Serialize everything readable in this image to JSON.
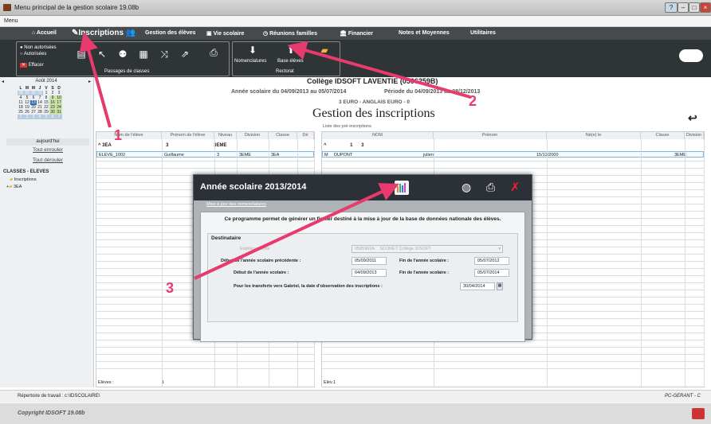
{
  "window": {
    "title": "Menu principal de la gestion scolaire 19.08b",
    "user_label": "PC-GERANT - C"
  },
  "menubar": {
    "menu": "Menu"
  },
  "nav": {
    "accueil": "Accueil",
    "inscriptions": "Inscriptions",
    "eleves": "Gestion des élèves",
    "vie": "Vie scolaire",
    "reunions": "Réunions familles",
    "financier": "Financier",
    "notes": "Notes et Moyennes",
    "utilitaires": "Utilitaires"
  },
  "ribbon": {
    "non_autorisees": "Non autorisées",
    "autorisees": "Autorisées",
    "effacer": "Effacer",
    "passages": "Passages de classes",
    "nomenclatures": "Nomenclatures",
    "base_eleves": "Base élèves",
    "rectorat": "Rectorat"
  },
  "calendar": {
    "month": "Août 2014",
    "days": [
      "L",
      "M",
      "M",
      "J",
      "V",
      "S",
      "D"
    ],
    "rows": [
      [
        "28",
        "29",
        "30",
        "31",
        "1",
        "2",
        "3"
      ],
      [
        "4",
        "5",
        "6",
        "7",
        "8",
        "9",
        "10"
      ],
      [
        "11",
        "12",
        "13",
        "14",
        "15",
        "16",
        "17"
      ],
      [
        "18",
        "19",
        "20",
        "21",
        "22",
        "23",
        "24"
      ],
      [
        "25",
        "26",
        "27",
        "28",
        "29",
        "30",
        "31"
      ],
      [
        "1",
        "2",
        "3",
        "4",
        "5",
        "6",
        "7"
      ]
    ],
    "today": "aujourd'hui",
    "enroll_all": "Tout enrouler",
    "unroll_all": "Tout dérouler"
  },
  "tree": {
    "title": "CLASSES - ELEVES",
    "items": [
      "Inscriptions",
      "3EA"
    ]
  },
  "header": {
    "college": "Collège IDSOFT LAVENTIE (0596259B)",
    "annee": "Année scolaire du 04/09/2013 au 05/07/2014",
    "periode": "Période du 04/09/2013 au 08/12/2013",
    "classe": "3 EURO - ANGLAIS EURO - 0",
    "page_title": "Gestion des inscriptions",
    "list_label": "Liste des pré-inscriptions"
  },
  "left_table": {
    "columns": [
      "Nom de l'élève",
      "Prénom de l'élève",
      "Niveau",
      "Division",
      "Classe",
      "Dé"
    ],
    "group": [
      "3EA",
      "3",
      "3EME"
    ],
    "row": [
      "ELEVE_1002",
      "Guillaume",
      "3",
      "3EME",
      "3EA",
      ""
    ],
    "footer_label": "Elèves :",
    "footer_count": "1"
  },
  "right_table": {
    "columns": [
      "NOM",
      "Prénom",
      "Né(e) le",
      "Classe",
      "Division"
    ],
    "group": [
      "1",
      "3"
    ],
    "row": [
      "M",
      "DUPONT",
      "julien",
      "15/12/2000",
      "",
      "3EME"
    ],
    "footer_label": "Elèv.1"
  },
  "dialog": {
    "title": "Année scolaire 2013/2014",
    "tab": "Mise à jour des nomenclatures",
    "intro": "Ce programme permet de générer un fichier destiné à la mise à jour de la base de données nationale des élèves.",
    "section": "Destinataire",
    "etab_label": "Etablissements",
    "etab_code": "0595962A",
    "etab_name": "SCONET Collège IDSOFT",
    "prev_start_label": "Début de l'année scolaire précédente :",
    "prev_start": "05/09/2011",
    "prev_end_label": "Fin de l'année scolaire :",
    "prev_end": "05/07/2012",
    "start_label": "Début de l'année scolaire :",
    "start": "04/09/2013",
    "end_label": "Fin de l'année scolaire :",
    "end": "05/07/2014",
    "transfer_label": "Pour les transferts vers Gabriel, la date d'observation des inscriptions :",
    "transfer": "30/04/2014"
  },
  "status": {
    "path": "Répertoire de travail : c:\\IDSCOLAIRE\\"
  },
  "footer": {
    "copyright": "Copyright IDSOFT 19.08b"
  },
  "annotations": [
    "1",
    "2",
    "3"
  ],
  "colors": {
    "accent": "#e83a6d",
    "nav": "#454a4d",
    "ribbon": "#2f3437"
  }
}
